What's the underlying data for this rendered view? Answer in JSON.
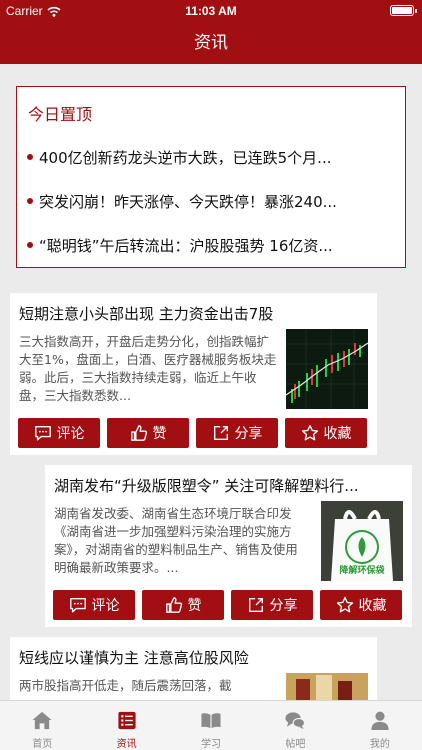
{
  "status_bar": {
    "carrier": "Carrier",
    "time": "11:03 AM"
  },
  "nav": {
    "title": "资讯"
  },
  "pinned": {
    "title": "今日置顶",
    "items": [
      "400亿创新药龙头逆市大跌，已连跌5个月...",
      "突发闪崩！昨天涨停、今天跌停！暴涨240...",
      "“聪明钱”午后转流出：沪股股强势 16亿资..."
    ]
  },
  "actions": {
    "comment": "评论",
    "like": "赞",
    "share": "分享",
    "favorite": "收藏"
  },
  "articles": [
    {
      "title": "短期注意小头部出现 主力资金出击7股",
      "summary": "三大指数高开，开盘后走势分化，创指跌幅扩大至1%，盘面上，白酒、医疗器械服务板块走弱。此后，三大指数持续走弱，临近上午收盘，三大指数悉数...",
      "thumb_icon": "stock-chart-thumbnail"
    },
    {
      "title": "湖南发布“升级版限塑令” 关注可降解塑料行...",
      "summary": "湖南省发改委、湖南省生态环境厅联合印发《湖南省进一步加强塑料污染治理的实施方案》，对湖南省的塑料制品生产、销售及使用明确最新政策要求。...",
      "thumb_icon": "biodegradable-bag-thumbnail",
      "thumb_text": "降解环保袋"
    },
    {
      "title": "短线应以谨慎为主 注意高位股风险",
      "summary": "两市股指高开低走，随后震荡回落，截",
      "thumb_icon": "liquor-thumbnail"
    }
  ],
  "tabs": [
    {
      "label": "首页",
      "icon": "home-icon"
    },
    {
      "label": "资讯",
      "icon": "news-icon",
      "active": true
    },
    {
      "label": "学习",
      "icon": "book-icon"
    },
    {
      "label": "帖吧",
      "icon": "chat-icon"
    },
    {
      "label": "我的",
      "icon": "user-icon"
    }
  ],
  "colors": {
    "brand": "#a20f12",
    "background": "#ebebeb"
  }
}
